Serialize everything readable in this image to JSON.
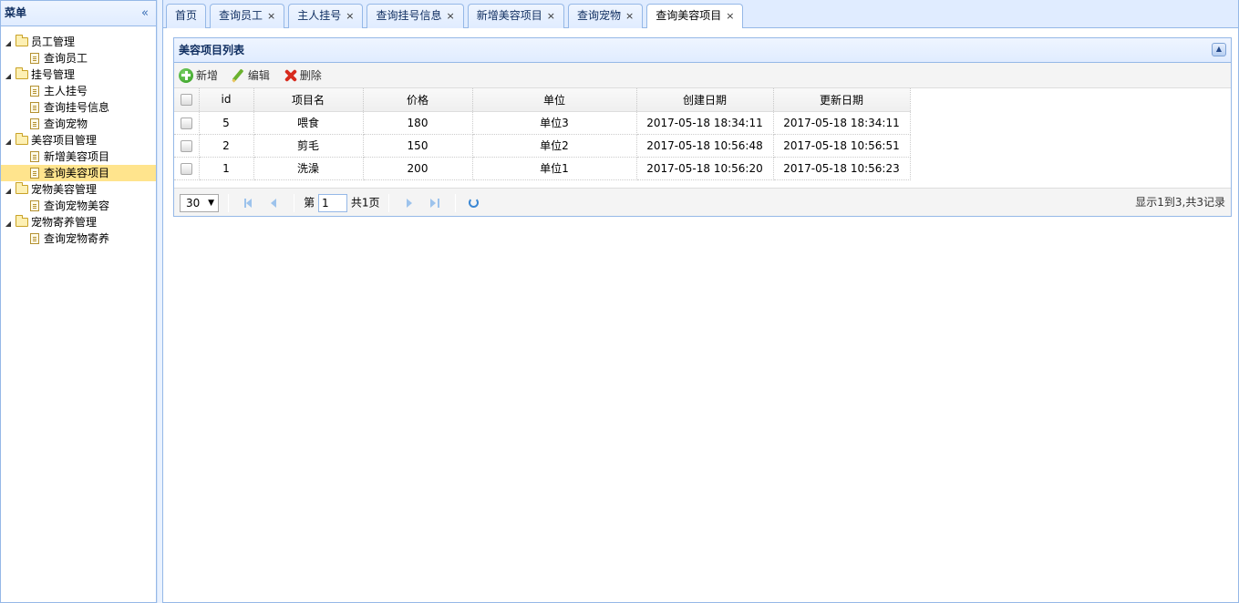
{
  "menu": {
    "title": "菜单",
    "collapse_icon": "«",
    "groups": [
      {
        "label": "员工管理",
        "items": [
          {
            "label": "查询员工",
            "selected": false
          }
        ]
      },
      {
        "label": "挂号管理",
        "items": [
          {
            "label": "主人挂号",
            "selected": false
          },
          {
            "label": "查询挂号信息",
            "selected": false
          },
          {
            "label": "查询宠物",
            "selected": false
          }
        ]
      },
      {
        "label": "美容项目管理",
        "items": [
          {
            "label": "新增美容项目",
            "selected": false
          },
          {
            "label": "查询美容项目",
            "selected": true
          }
        ]
      },
      {
        "label": "宠物美容管理",
        "items": [
          {
            "label": "查询宠物美容",
            "selected": false
          }
        ]
      },
      {
        "label": "宠物寄养管理",
        "items": [
          {
            "label": "查询宠物寄养",
            "selected": false
          }
        ]
      }
    ]
  },
  "tabs": [
    {
      "label": "首页",
      "closable": false,
      "active": false
    },
    {
      "label": "查询员工",
      "closable": true,
      "active": false
    },
    {
      "label": "主人挂号",
      "closable": true,
      "active": false
    },
    {
      "label": "查询挂号信息",
      "closable": true,
      "active": false
    },
    {
      "label": "新增美容项目",
      "closable": true,
      "active": false
    },
    {
      "label": "查询宠物",
      "closable": true,
      "active": false
    },
    {
      "label": "查询美容项目",
      "closable": true,
      "active": true
    }
  ],
  "tab_close_glyph": "×",
  "grid": {
    "title": "美容项目列表",
    "toolbar": {
      "add_label": "新增",
      "edit_label": "编辑",
      "delete_label": "删除"
    },
    "columns": [
      "id",
      "项目名",
      "价格",
      "单位",
      "创建日期",
      "更新日期"
    ],
    "rows": [
      [
        "5",
        "喂食",
        "180",
        "单位3",
        "2017-05-18 18:34:11",
        "2017-05-18 18:34:11"
      ],
      [
        "2",
        "剪毛",
        "150",
        "单位2",
        "2017-05-18 10:56:48",
        "2017-05-18 10:56:51"
      ],
      [
        "1",
        "洗澡",
        "200",
        "单位1",
        "2017-05-18 10:56:20",
        "2017-05-18 10:56:23"
      ]
    ],
    "pager": {
      "page_size": "30",
      "page_prefix": "第",
      "page_number": "1",
      "page_total": "共1页",
      "info": "显示1到3,共3记录"
    }
  },
  "colors": {
    "border": "#95b8e7",
    "header_bg": "#e0ecff",
    "selected_bg": "#ffe48d",
    "title_text": "#0e2d5f"
  }
}
